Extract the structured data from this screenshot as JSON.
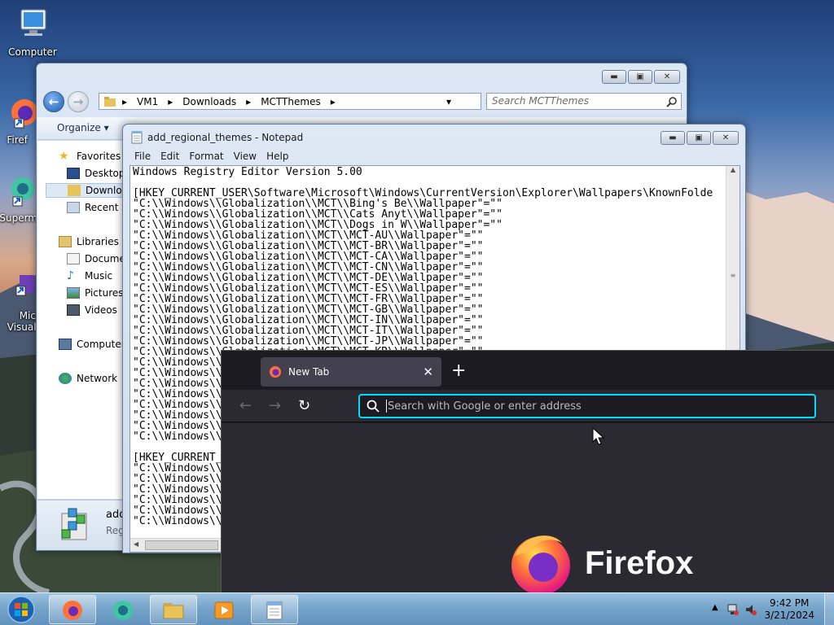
{
  "desktop": {
    "icons": [
      {
        "label": "Computer"
      },
      {
        "label": "Firef"
      },
      {
        "label": "Superm"
      },
      {
        "label": "Micro\nVisual S"
      }
    ]
  },
  "explorer": {
    "breadcrumb": [
      "VM1",
      "Downloads",
      "MCTThemes"
    ],
    "search_placeholder": "Search MCTThemes",
    "toolbar": {
      "organize_label": "Organize"
    },
    "sidebar": {
      "favorites": "Favorites",
      "desktop": "Desktop",
      "downloads": "Downloa",
      "recent": "Recent P",
      "libraries": "Libraries",
      "documents": "Documer",
      "music": "Music",
      "pictures": "Pictures",
      "videos": "Videos",
      "computer": "Computer",
      "network": "Network"
    },
    "details": {
      "name": "add",
      "type": "Reg"
    }
  },
  "notepad": {
    "title": "add_regional_themes - Notepad",
    "menu": [
      "File",
      "Edit",
      "Format",
      "View",
      "Help"
    ],
    "lines": [
      "Windows Registry Editor Version 5.00",
      "",
      "[HKEY_CURRENT_USER\\Software\\Microsoft\\Windows\\CurrentVersion\\Explorer\\Wallpapers\\KnownFolde",
      "\"C:\\\\Windows\\\\Globalization\\\\MCT\\\\Bing's Be\\\\Wallpaper\"=\"\"",
      "\"C:\\\\Windows\\\\Globalization\\\\MCT\\\\Cats Anyt\\\\Wallpaper\"=\"\"",
      "\"C:\\\\Windows\\\\Globalization\\\\MCT\\\\Dogs in W\\\\Wallpaper\"=\"\"",
      "\"C:\\\\Windows\\\\Globalization\\\\MCT\\\\MCT-AU\\\\Wallpaper\"=\"\"",
      "\"C:\\\\Windows\\\\Globalization\\\\MCT\\\\MCT-BR\\\\Wallpaper\"=\"\"",
      "\"C:\\\\Windows\\\\Globalization\\\\MCT\\\\MCT-CA\\\\Wallpaper\"=\"\"",
      "\"C:\\\\Windows\\\\Globalization\\\\MCT\\\\MCT-CN\\\\Wallpaper\"=\"\"",
      "\"C:\\\\Windows\\\\Globalization\\\\MCT\\\\MCT-DE\\\\Wallpaper\"=\"\"",
      "\"C:\\\\Windows\\\\Globalization\\\\MCT\\\\MCT-ES\\\\Wallpaper\"=\"\"",
      "\"C:\\\\Windows\\\\Globalization\\\\MCT\\\\MCT-FR\\\\Wallpaper\"=\"\"",
      "\"C:\\\\Windows\\\\Globalization\\\\MCT\\\\MCT-GB\\\\Wallpaper\"=\"\"",
      "\"C:\\\\Windows\\\\Globalization\\\\MCT\\\\MCT-IN\\\\Wallpaper\"=\"\"",
      "\"C:\\\\Windows\\\\Globalization\\\\MCT\\\\MCT-IT\\\\Wallpaper\"=\"\"",
      "\"C:\\\\Windows\\\\Globalization\\\\MCT\\\\MCT-JP\\\\Wallpaper\"=\"\"",
      "\"C:\\\\Windows\\\\Globalization\\\\MCT\\\\MCT-KR\\\\Wallpaper\"=\"\"",
      "\"C:\\\\Windows\\\\",
      "\"C:\\\\Windows\\\\",
      "\"C:\\\\Windows\\\\",
      "\"C:\\\\Windows\\\\",
      "\"C:\\\\Windows\\\\",
      "\"C:\\\\Windows\\\\",
      "\"C:\\\\Windows\\\\",
      "\"C:\\\\Windows\\\\",
      "",
      "[HKEY_CURRENT_",
      "\"C:\\\\Windows\\\\",
      "\"C:\\\\Windows\\\\",
      "\"C:\\\\Windows\\\\",
      "\"C:\\\\Windows\\\\",
      "\"C:\\\\Windows\\\\",
      "\"C:\\\\Windows\\\\"
    ]
  },
  "firefox": {
    "tab_title": "New Tab",
    "url_placeholder": "Search with Google or enter address",
    "brand": "Firefox",
    "accent": "#00ddff"
  },
  "taskbar": {
    "time": "9:42 PM",
    "date": "3/21/2024"
  }
}
